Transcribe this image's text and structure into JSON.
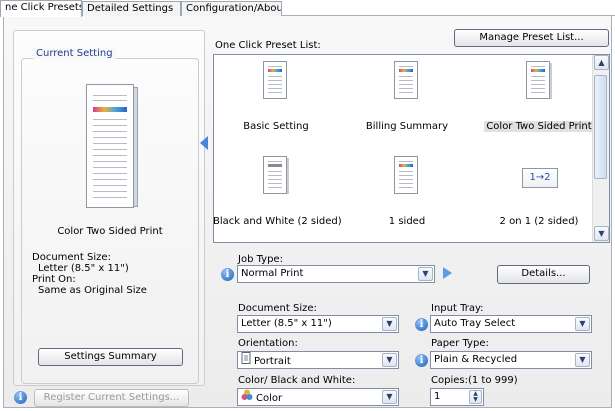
{
  "tabs": [
    {
      "label": "ne Click Presets"
    },
    {
      "label": "Detailed Settings"
    },
    {
      "label": "Configuration/About"
    }
  ],
  "current_setting": {
    "group_label": "Current Setting",
    "preset_name": "Color Two Sided Print",
    "document_size_label": "Document Size:",
    "document_size_value": "Letter (8.5\" x 11\")",
    "print_on_label": "Print On:",
    "print_on_value": "Same as Original Size",
    "settings_summary_button": "Settings Summary",
    "register_button": "Register Current Settings..."
  },
  "preset_list": {
    "label": "One Click Preset List:",
    "manage_button": "Manage Preset List...",
    "items": [
      {
        "label": "Basic Setting",
        "icon": "color-document-icon",
        "selected": false
      },
      {
        "label": "Billing Summary",
        "icon": "color-document-icon",
        "selected": false
      },
      {
        "label": "Color Two Sided Print",
        "icon": "color-two-sided-document-icon",
        "selected": true
      },
      {
        "label": "Black and White (2 sided)",
        "icon": "grayscale-document-icon",
        "selected": false
      },
      {
        "label": "1 sided",
        "icon": "color-document-icon",
        "selected": false
      },
      {
        "label": "2 on 1 (2 sided)",
        "icon": "two-on-one-icon",
        "selected": false
      }
    ],
    "two_on_one_glyph": "1→2"
  },
  "job": {
    "label": "Job Type:",
    "value": "Normal Print",
    "details_button": "Details..."
  },
  "document_size": {
    "label": "Document Size:",
    "value": "Letter (8.5\" x 11\")"
  },
  "input_tray": {
    "label": "Input Tray:",
    "value": "Auto Tray Select"
  },
  "orientation": {
    "label": "Orientation:",
    "value": "Portrait"
  },
  "paper_type": {
    "label": "Paper Type:",
    "value": "Plain & Recycled"
  },
  "color_mode": {
    "label": "Color/ Black and White:",
    "value": "Color"
  },
  "copies": {
    "label": "Copies:(1 to 999)",
    "value": "1"
  },
  "colors": {
    "accent": "#1d5fb8",
    "selection": "#e1e1e1",
    "pointer": "#4a86d8"
  }
}
